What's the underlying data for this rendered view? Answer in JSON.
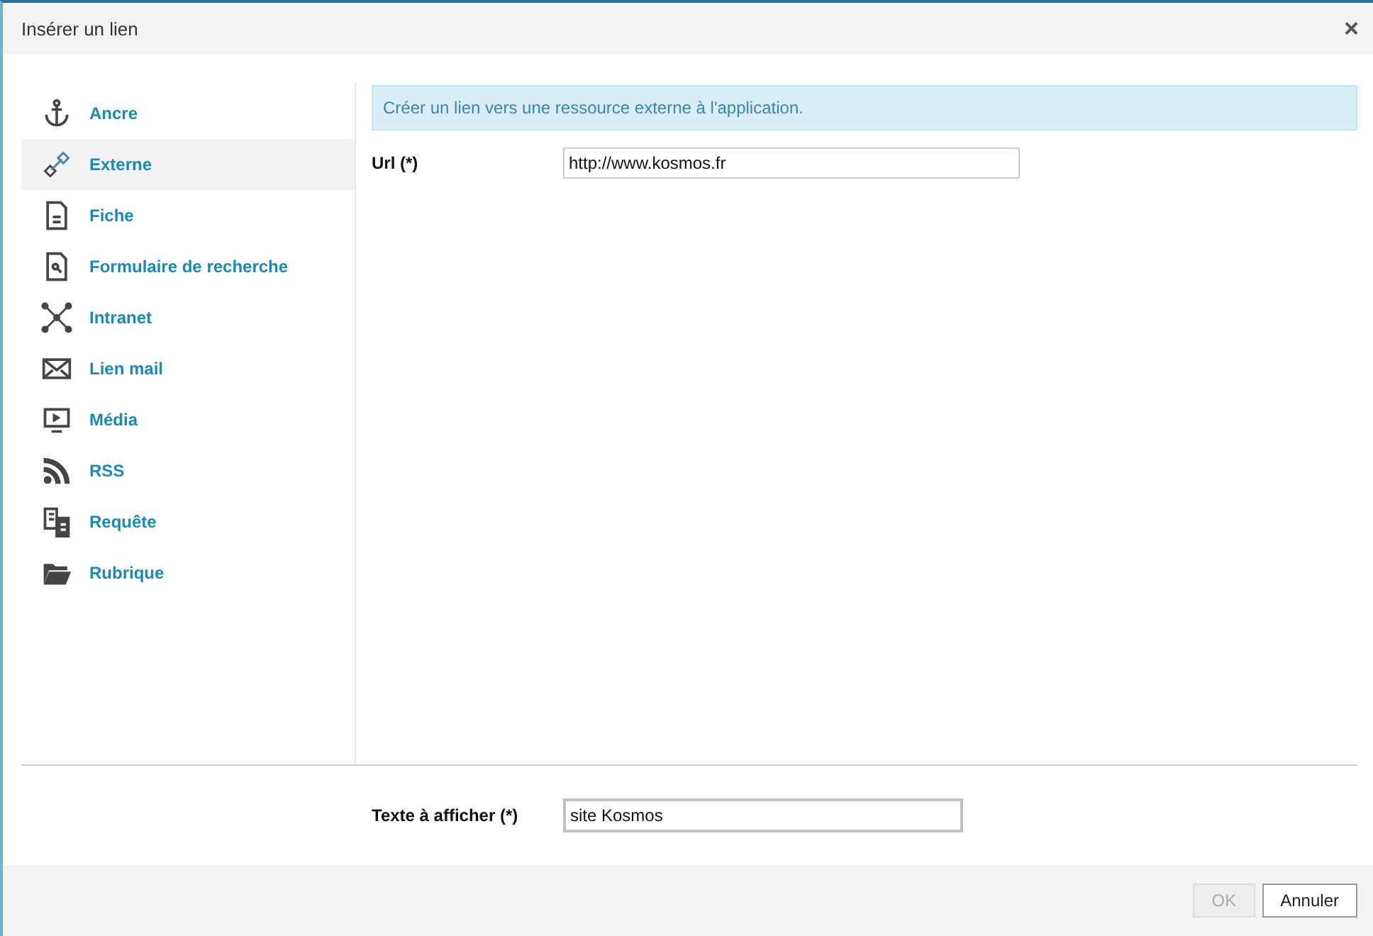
{
  "window": {
    "title": "Insérer un lien",
    "close": "×"
  },
  "sidebar": {
    "items": [
      {
        "kind": "anchor",
        "label": "Ancre",
        "selected": false
      },
      {
        "kind": "link",
        "label": "Externe",
        "selected": true
      },
      {
        "kind": "document",
        "label": "Fiche",
        "selected": false
      },
      {
        "kind": "searchdoc",
        "label": "Formulaire de recherche",
        "selected": false
      },
      {
        "kind": "network",
        "label": "Intranet",
        "selected": false
      },
      {
        "kind": "mail",
        "label": "Lien mail",
        "selected": false
      },
      {
        "kind": "monitor",
        "label": "Média",
        "selected": false
      },
      {
        "kind": "rss",
        "label": "RSS",
        "selected": false
      },
      {
        "kind": "documents",
        "label": "Requête",
        "selected": false
      },
      {
        "kind": "folder",
        "label": "Rubrique",
        "selected": false
      }
    ]
  },
  "info": "Créer un lien vers une ressource externe à l'application.",
  "url": {
    "label": "Url (*)",
    "value": "http://www.kosmos.fr"
  },
  "display_text": {
    "label": "Texte à afficher (*)",
    "value": "site Kosmos"
  },
  "buttons": [
    {
      "label": "OK",
      "disabled": true
    },
    {
      "label": "Annuler",
      "disabled": false
    }
  ]
}
